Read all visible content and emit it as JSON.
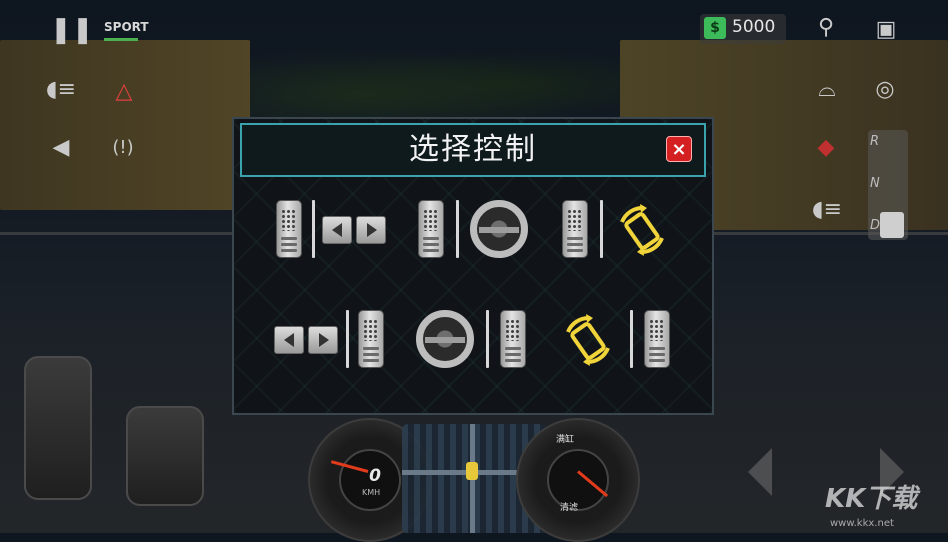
{
  "hud": {
    "sport_label": "SPORT",
    "money": "5000",
    "gears": [
      "R",
      "N",
      "D"
    ]
  },
  "dialog": {
    "title": "选择控制",
    "close_label": "×",
    "options_row1": [
      {
        "name": "pedal-arrows-pedal",
        "layout": [
          "pedal",
          "arrows"
        ]
      },
      {
        "name": "pedal-wheel",
        "layout": [
          "pedal",
          "wheel"
        ]
      },
      {
        "name": "pedal-tilt",
        "layout": [
          "pedal",
          "tilt"
        ]
      }
    ],
    "options_row2": [
      {
        "name": "arrows-pedal",
        "layout": [
          "arrows",
          "pedal"
        ]
      },
      {
        "name": "wheel-pedal",
        "layout": [
          "wheel",
          "pedal"
        ]
      },
      {
        "name": "tilt-pedal",
        "layout": [
          "tilt",
          "pedal"
        ]
      }
    ]
  },
  "dashboard": {
    "speed": "0",
    "speed_unit": "KMH",
    "fuel_labels": [
      "满缸",
      "清滤"
    ]
  },
  "watermark": {
    "brand": "KK下载",
    "url": "www.kkx.net"
  },
  "colors": {
    "accent": "#3aa3ad",
    "close": "#d42020",
    "tilt_icon": "#f0d43a"
  }
}
